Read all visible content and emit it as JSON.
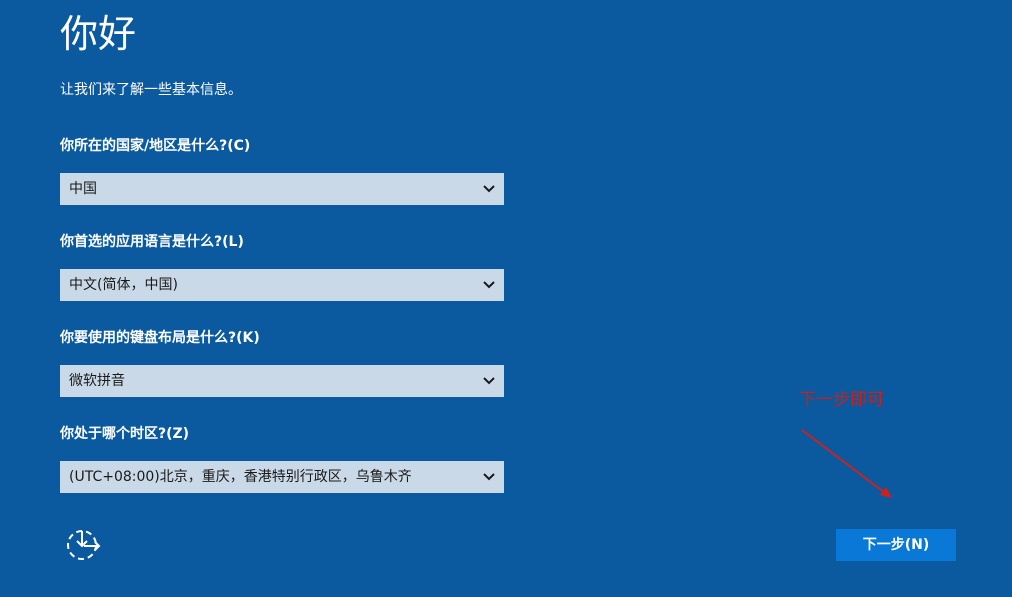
{
  "header": {
    "title": "你好",
    "subtitle": "让我们来了解一些基本信息。"
  },
  "form": {
    "country": {
      "label": "你所在的国家/地区是什么?(C)",
      "value": "中国"
    },
    "app_language": {
      "label": "你首选的应用语言是什么?(L)",
      "value": "中文(简体，中国)"
    },
    "keyboard": {
      "label": "你要使用的键盘布局是什么?(K)",
      "value": "微软拼音"
    },
    "timezone": {
      "label": "你处于哪个时区?(Z)",
      "value": "(UTC+08:00)北京，重庆，香港特别行政区，乌鲁木齐"
    }
  },
  "footer": {
    "next_label": "下一步(N)",
    "accessibility_icon": "ease-of-access-icon"
  },
  "annotation": {
    "text": "下一步即可",
    "color": "#c8201a"
  },
  "colors": {
    "background": "#0b5aa0",
    "select_bg": "#cad9e8",
    "button_bg": "#0a78d7"
  }
}
